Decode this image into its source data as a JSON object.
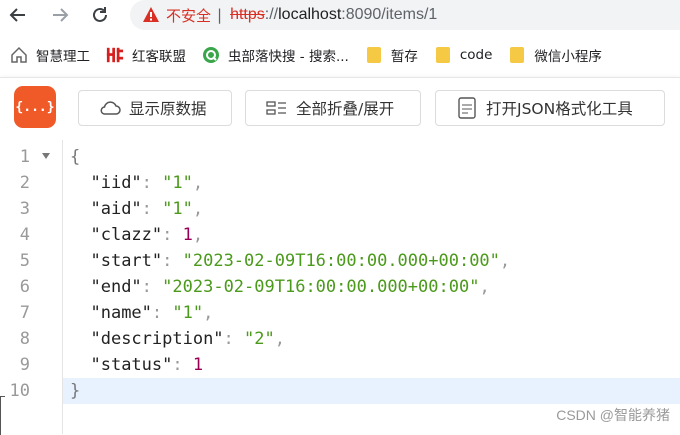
{
  "address_bar": {
    "security_label": "不安全",
    "separator": "|",
    "url_protocol": "https",
    "url_protocol_rest": "://",
    "url_host": "localhost",
    "url_path": ":8090/items/1"
  },
  "bookmarks": [
    {
      "label": "智慧理工",
      "icon": "home-icon"
    },
    {
      "label": "红客联盟",
      "icon": "hk-logo-icon"
    },
    {
      "label": "虫部落快搜 - 搜索...",
      "icon": "q-logo-icon"
    },
    {
      "label": "暂存",
      "icon": "folder-icon"
    },
    {
      "label": "code",
      "icon": "folder-icon"
    },
    {
      "label": "微信小程序",
      "icon": "folder-icon"
    }
  ],
  "toolbar": {
    "logo_text": "{...}",
    "raw_button": "显示原数据",
    "fold_button": "全部折叠/展开",
    "json_tool_button": "打开JSON格式化工具"
  },
  "json_lines": [
    {
      "n": "1",
      "open": "{"
    },
    {
      "n": "2",
      "key": "\"iid\"",
      "val": "\"1\"",
      "type": "s",
      "comma": ","
    },
    {
      "n": "3",
      "key": "\"aid\"",
      "val": "\"1\"",
      "type": "s",
      "comma": ","
    },
    {
      "n": "4",
      "key": "\"clazz\"",
      "val": "1",
      "type": "n",
      "comma": ","
    },
    {
      "n": "5",
      "key": "\"start\"",
      "val": "\"2023-02-09T16:00:00.000+00:00\"",
      "type": "s",
      "comma": ","
    },
    {
      "n": "6",
      "key": "\"end\"",
      "val": "\"2023-02-09T16:00:00.000+00:00\"",
      "type": "s",
      "comma": ","
    },
    {
      "n": "7",
      "key": "\"name\"",
      "val": "\"1\"",
      "type": "s",
      "comma": ","
    },
    {
      "n": "8",
      "key": "\"description\"",
      "val": "\"2\"",
      "type": "s",
      "comma": ","
    },
    {
      "n": "9",
      "key": "\"status\"",
      "val": "1",
      "type": "n",
      "comma": ""
    },
    {
      "n": "10",
      "close": "}"
    }
  ],
  "watermark": "CSDN @智能养猪",
  "colors": {
    "logo_bg": "#f05a28",
    "string": "#4b9a1b",
    "number": "#990055",
    "insecure": "#d93025",
    "active_line": "#e8f2ff"
  }
}
